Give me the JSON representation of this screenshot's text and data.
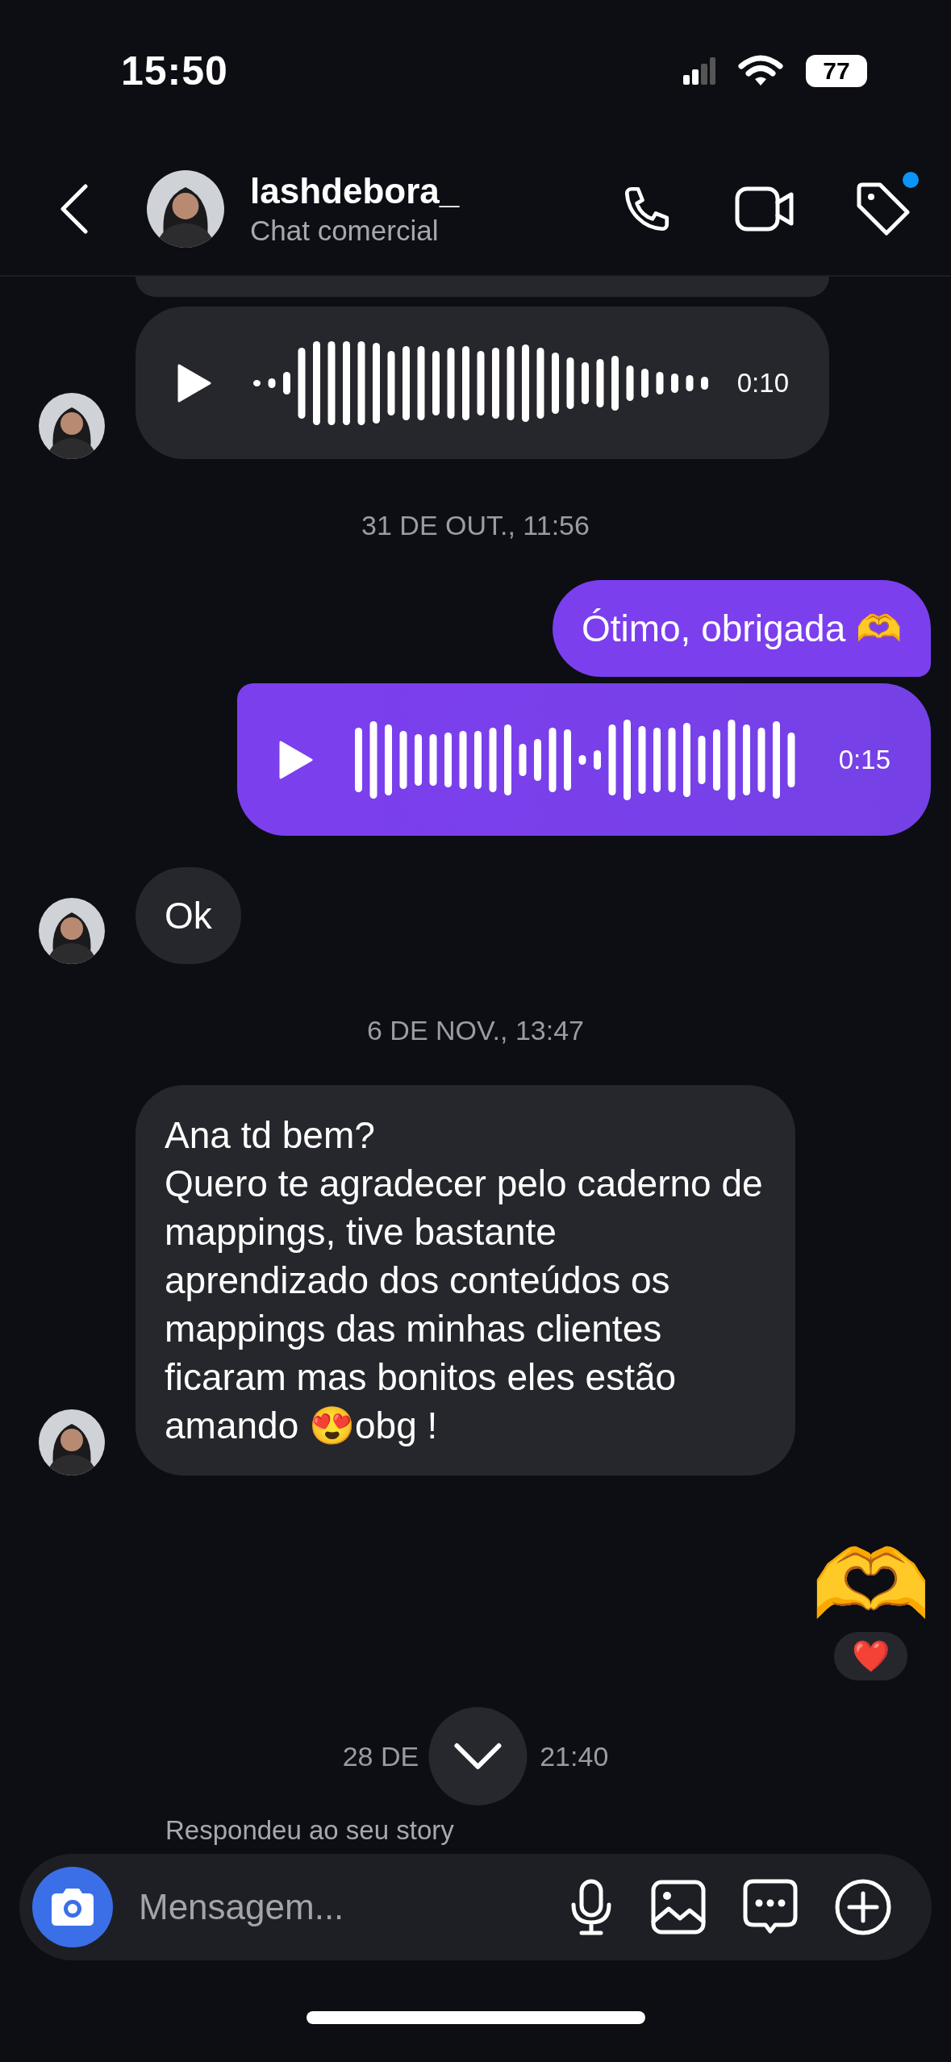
{
  "status_bar": {
    "time": "15:50",
    "battery": "77"
  },
  "header": {
    "name": "lashdebora_",
    "subtitle": "Chat comercial",
    "tag_badge": true
  },
  "messages": [
    {
      "kind": "clipped",
      "outgoing": false
    },
    {
      "kind": "audio",
      "outgoing": false,
      "duration": "0:10",
      "avatar": true
    },
    {
      "kind": "date",
      "text": "31 DE OUT., 11:56"
    },
    {
      "kind": "text",
      "outgoing": true,
      "text": "Ótimo, obrigada 🫶"
    },
    {
      "kind": "audio",
      "outgoing": true,
      "duration": "0:15"
    },
    {
      "kind": "text",
      "outgoing": false,
      "text": "Ok",
      "avatar": true
    },
    {
      "kind": "date",
      "text": "6 DE NOV., 13:47"
    },
    {
      "kind": "text",
      "outgoing": false,
      "text": "Ana td bem?\nQuero te agradecer pelo caderno de mappings, tive bastante aprendizado dos conteúdos os mappings das minhas clientes ficaram mas bonitos eles estão amando 😍obg !",
      "avatar": true
    },
    {
      "kind": "emoji",
      "outgoing": true,
      "text": "🫶",
      "reaction": "❤️"
    },
    {
      "kind": "covered_date",
      "parts": [
        "28 DE",
        "21:40"
      ]
    },
    {
      "kind": "note",
      "text": "Respondeu ao seu story"
    }
  ],
  "composer": {
    "placeholder": "Mensagem..."
  }
}
